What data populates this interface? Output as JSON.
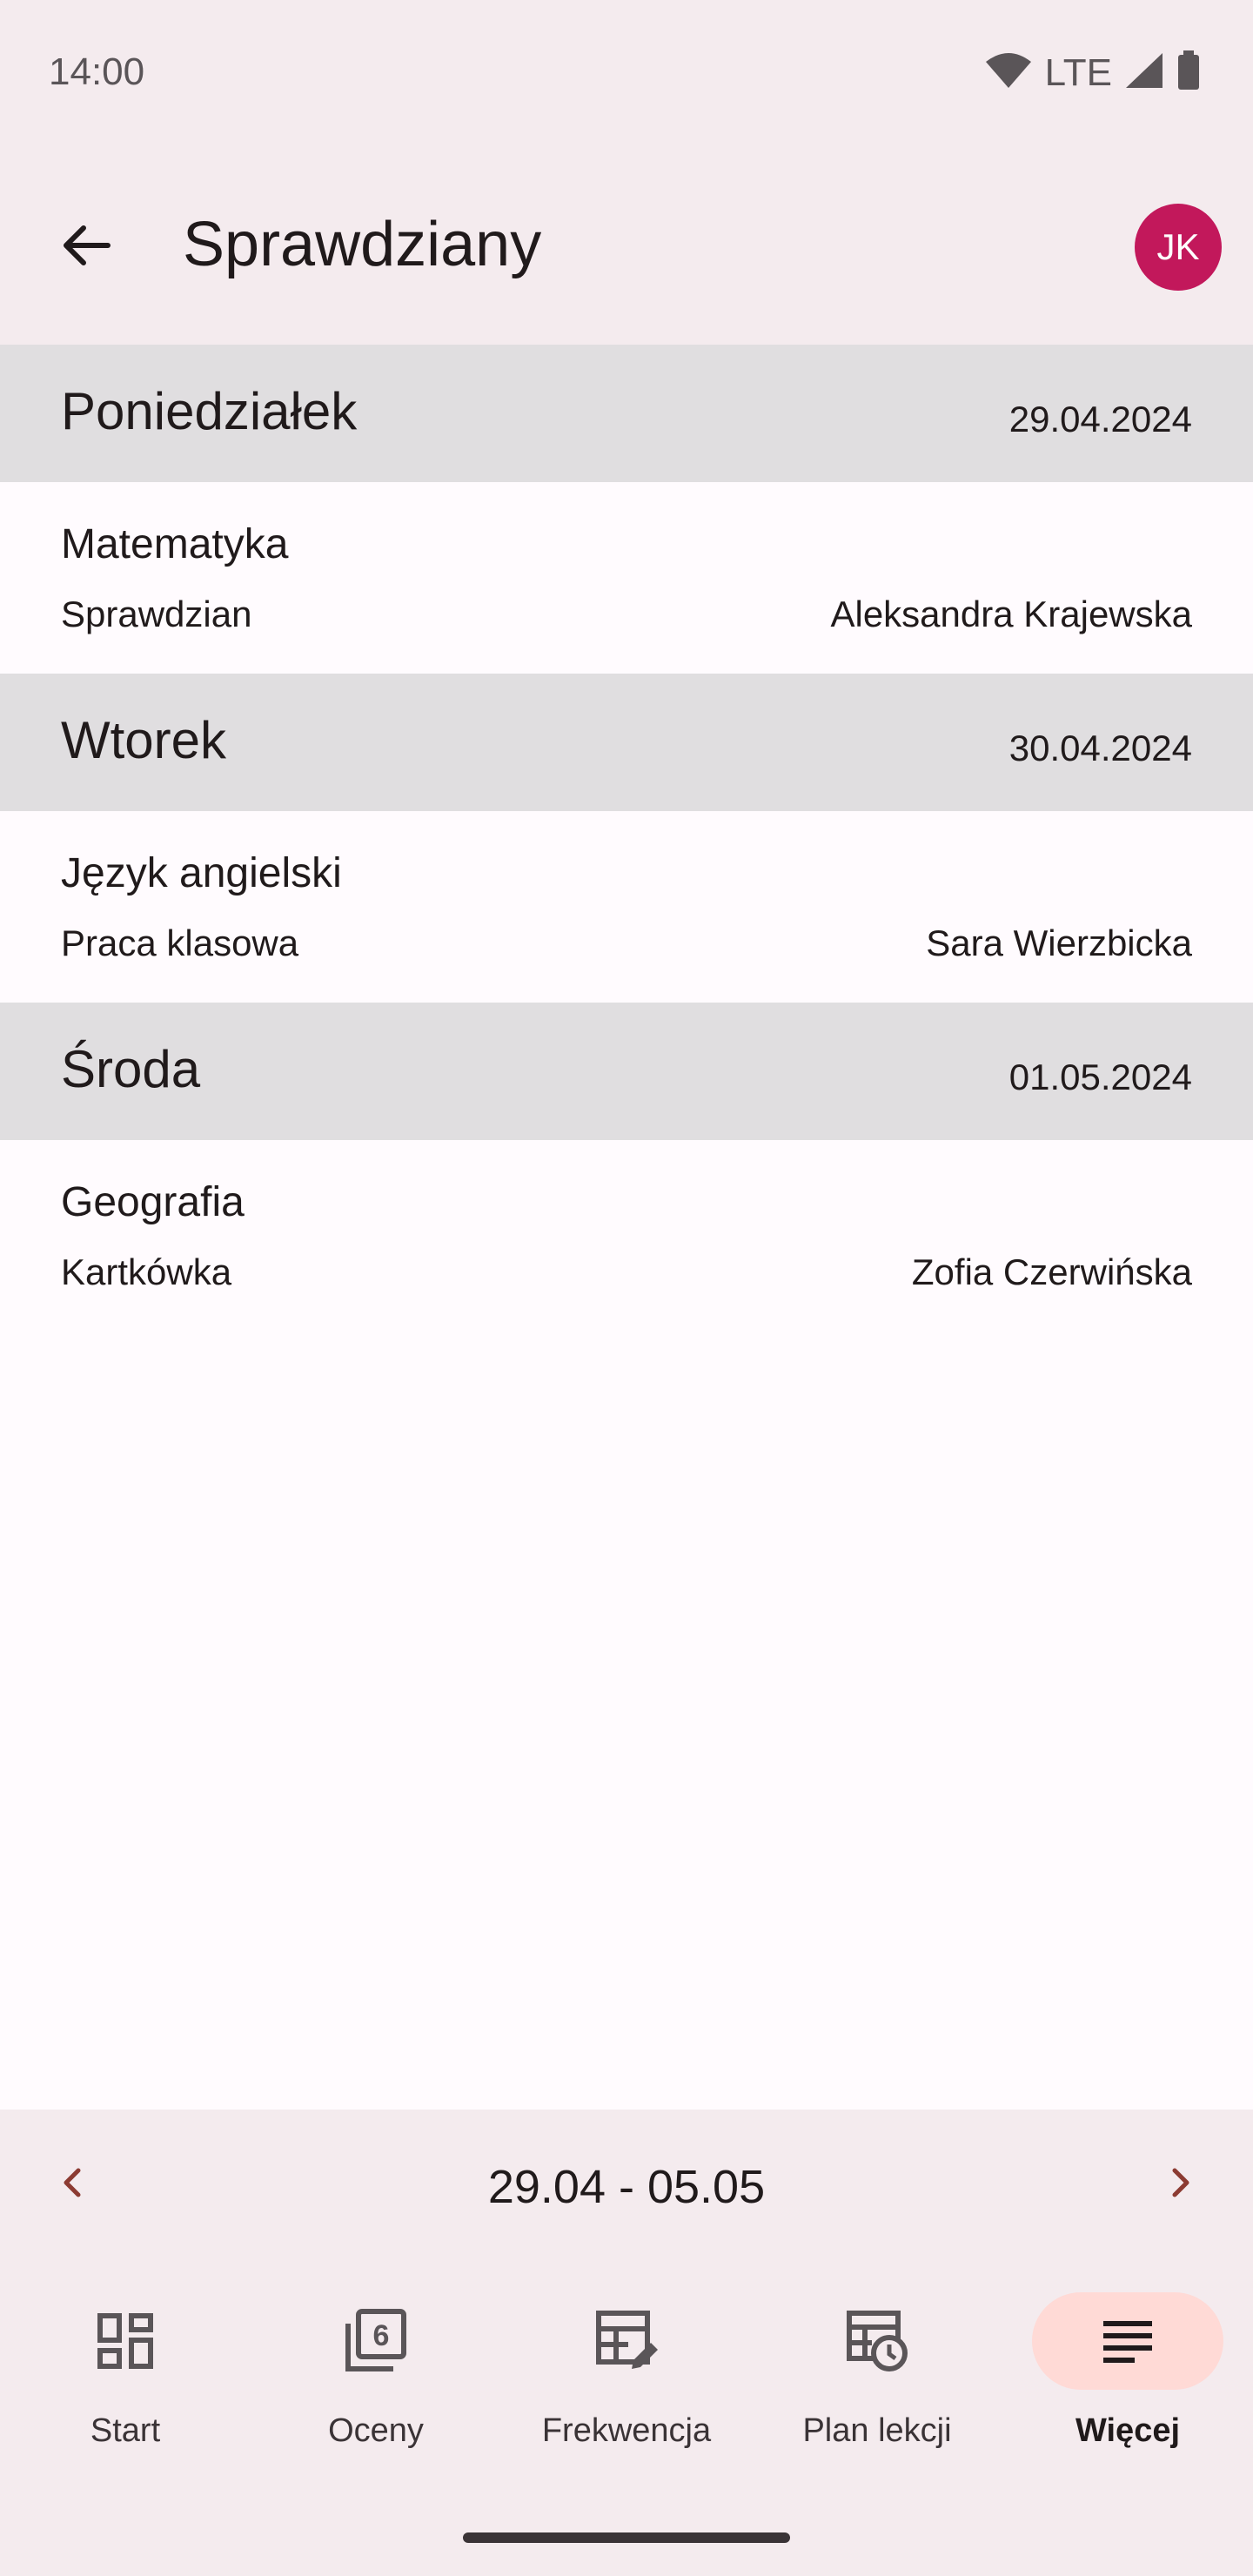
{
  "status_bar": {
    "time": "14:00",
    "network": "LTE"
  },
  "app_bar": {
    "title": "Sprawdziany",
    "avatar_initials": "JK"
  },
  "days": [
    {
      "name": "Poniedziałek",
      "date": "29.04.2024",
      "exams": [
        {
          "subject": "Matematyka",
          "type": "Sprawdzian",
          "teacher": "Aleksandra Krajewska"
        }
      ]
    },
    {
      "name": "Wtorek",
      "date": "30.04.2024",
      "exams": [
        {
          "subject": "Język angielski",
          "type": "Praca klasowa",
          "teacher": "Sara Wierzbicka"
        }
      ]
    },
    {
      "name": "Środa",
      "date": "01.05.2024",
      "exams": [
        {
          "subject": "Geografia",
          "type": "Kartkówka",
          "teacher": "Zofia Czerwińska"
        }
      ]
    }
  ],
  "week_nav": {
    "range": "29.04 - 05.05"
  },
  "bottom_nav": {
    "items": [
      {
        "label": "Start",
        "icon": "dashboard-icon"
      },
      {
        "label": "Oceny",
        "icon": "grades-icon"
      },
      {
        "label": "Frekwencja",
        "icon": "attendance-icon"
      },
      {
        "label": "Plan lekcji",
        "icon": "timetable-icon"
      },
      {
        "label": "Więcej",
        "icon": "more-icon",
        "active": true
      }
    ]
  },
  "colors": {
    "accent": "#c2185b",
    "active_pill": "#ffdad6",
    "surface": "#f4ebee",
    "header_band": "#e0dee0"
  }
}
